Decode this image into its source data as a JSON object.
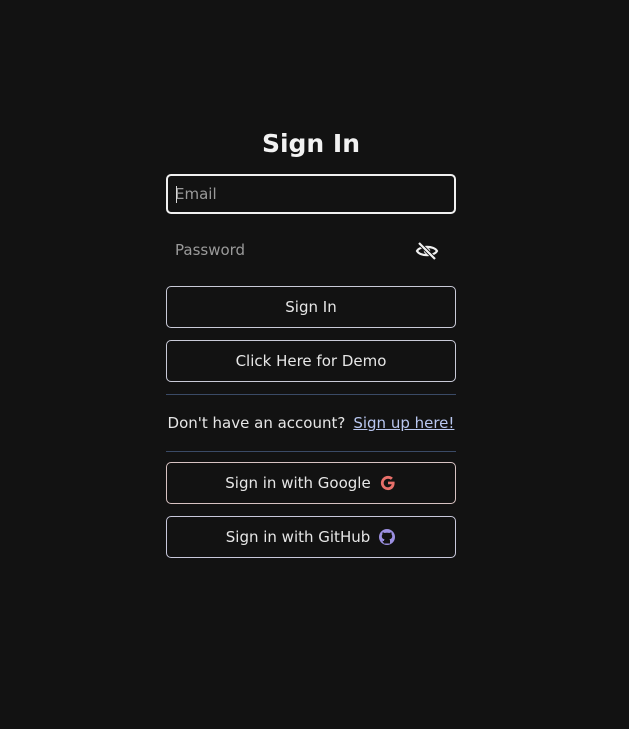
{
  "form": {
    "title": "Sign In",
    "email_placeholder": "Email",
    "password_placeholder": "Password",
    "signin_label": "Sign In",
    "demo_label": "Click Here for Demo",
    "signup_prompt": "Don't have an account?",
    "signup_link": "Sign up here!",
    "google_label": "Sign in with Google",
    "github_label": "Sign in with GitHub"
  },
  "icons": {
    "password_toggle": "eye-slash-icon",
    "google": "google-icon",
    "github": "github-icon"
  },
  "colors": {
    "background": "#121212",
    "google_icon": "#e8706a",
    "github_icon": "#9b8fe0",
    "link": "#b9c7f0",
    "divider": "#3a4a66"
  }
}
